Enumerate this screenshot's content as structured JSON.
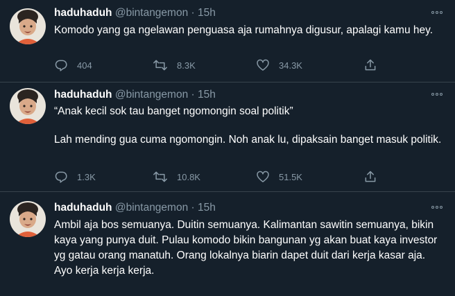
{
  "tweets": [
    {
      "name": "haduhaduh",
      "handle": "@bintangemon",
      "time": "· 15h",
      "paragraphs": [
        "Komodo yang ga ngelawan penguasa aja rumahnya digusur, apalagi kamu hey."
      ],
      "replies": "404",
      "retweets": "8.3K",
      "likes": "34.3K"
    },
    {
      "name": "haduhaduh",
      "handle": "@bintangemon",
      "time": "· 15h",
      "paragraphs": [
        "“Anak kecil sok tau banget ngomongin soal politik”",
        "Lah mending gua cuma ngomongin. Noh anak lu, dipaksain banget masuk politik."
      ],
      "replies": "1.3K",
      "retweets": "10.8K",
      "likes": "51.5K"
    },
    {
      "name": "haduhaduh",
      "handle": "@bintangemon",
      "time": "· 15h",
      "paragraphs": [
        "Ambil aja bos semuanya. Duitin semuanya. Kalimantan sawitin semuanya, bikin kaya yang punya duit. Pulau komodo bikin bangunan yg akan buat kaya investor yg gatau orang manatuh. Orang lokalnya biarin dapet duit dari kerja kasar aja.",
        "Ayo kerja kerja kerja."
      ]
    }
  ],
  "icons": {
    "reply": "reply-icon",
    "retweet": "retweet-icon",
    "like": "heart-icon",
    "share": "share-icon",
    "more": "more-options-icon"
  },
  "colors": {
    "background": "#15202b",
    "text": "#ffffff",
    "secondary": "#8899a6",
    "divider": "#38444d"
  }
}
